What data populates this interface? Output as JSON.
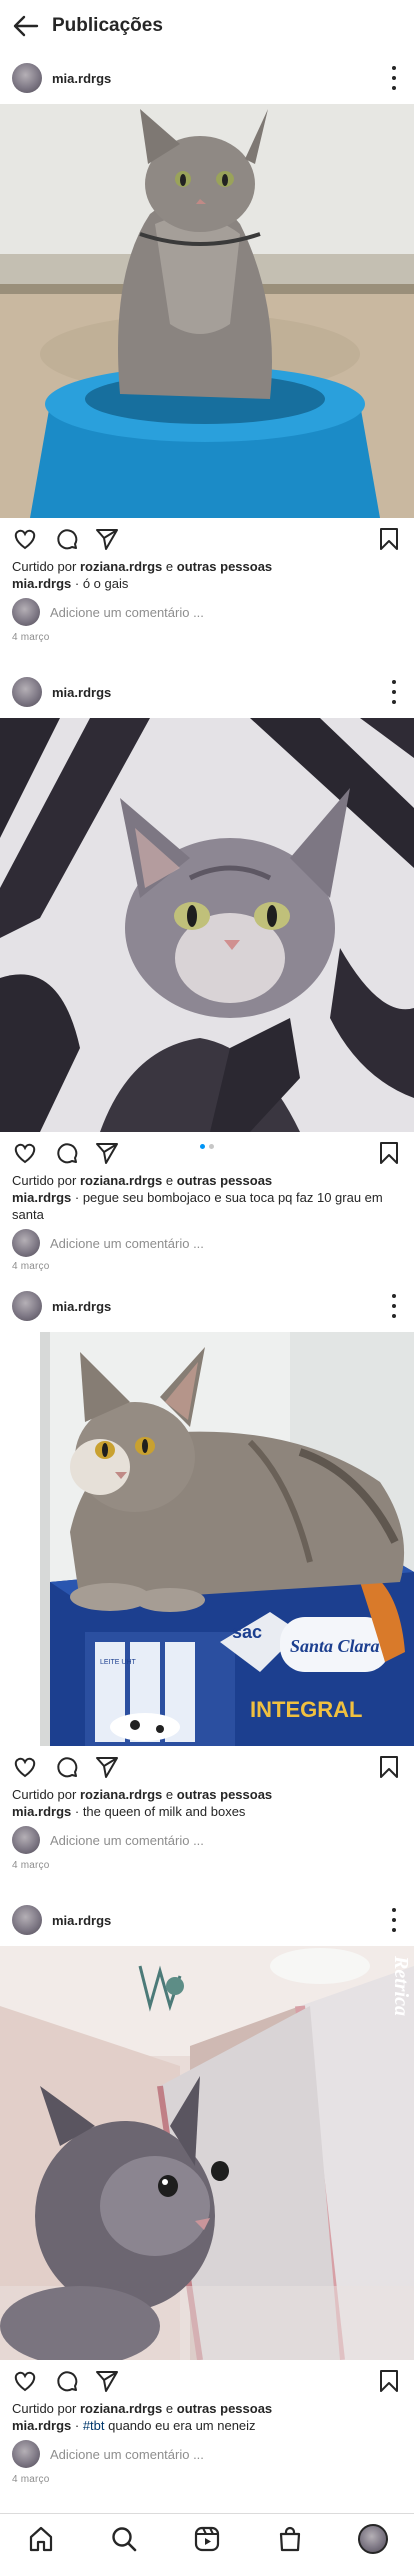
{
  "header": {
    "title": "Publicações",
    "back_icon": "arrow-left-icon"
  },
  "posts": [
    {
      "username": "mia.rdrgs",
      "liked_prefix": "Curtido por",
      "liked_user": "roziana.rdrgs",
      "liked_joiner": "e",
      "liked_others": "outras pessoas",
      "caption_user": "mia.rdrgs",
      "caption_sep": " · ",
      "caption_text": "ó o gais",
      "hashtag": "",
      "comment_placeholder": "Adicione um comentário ...",
      "date": "4 março",
      "photo_icon": "cat-on-blue-stool-photo"
    },
    {
      "username": "mia.rdrgs",
      "liked_prefix": "Curtido por",
      "liked_user": "roziana.rdrgs",
      "liked_joiner": "e",
      "liked_others": "outras pessoas",
      "caption_user": "mia.rdrgs",
      "caption_sep": " · ",
      "caption_text": "pegue seu bombojaco e sua toca pq faz 10 grau em santa",
      "hashtag": "",
      "comment_placeholder": "Adicione um comentário ...",
      "date": "4 março",
      "carousel": {
        "count": 2,
        "active": 1
      },
      "photo_icon": "cat-in-zebra-blanket-photo"
    },
    {
      "username": "mia.rdrgs",
      "liked_prefix": "Curtido por",
      "liked_user": "roziana.rdrgs",
      "liked_joiner": "e",
      "liked_others": "outras pessoas",
      "caption_user": "mia.rdrgs",
      "caption_sep": " · ",
      "caption_text": "the queen of milk and boxes",
      "hashtag": "",
      "comment_placeholder": "Adicione um comentário ...",
      "date": "4 março",
      "photo_icon": "cat-on-milk-box-photo",
      "box_texts": {
        "brand": "Santa Clara",
        "integral": "INTEGRAL",
        "leite": "LEITE UHT",
        "sac": "sac"
      }
    },
    {
      "username": "mia.rdrgs",
      "liked_prefix": "Curtido por",
      "liked_user": "roziana.rdrgs",
      "liked_joiner": "e",
      "liked_others": "outras pessoas",
      "caption_user": "mia.rdrgs",
      "caption_sep": " · ",
      "caption_text": " quando eu era um neneiz",
      "hashtag": "#tbt",
      "comment_placeholder": "Adicione um comentário ...",
      "date": "4 março",
      "photo_icon": "kitten-in-mirror-photo",
      "watermark": "Retrica"
    }
  ],
  "bottom_nav": [
    {
      "icon": "home-icon"
    },
    {
      "icon": "search-icon"
    },
    {
      "icon": "reels-icon"
    },
    {
      "icon": "shop-icon"
    },
    {
      "icon": "profile-avatar-icon"
    }
  ],
  "colors": {
    "accent": "#0095f6",
    "text": "#262626",
    "muted": "#8e8e8e",
    "hashtag": "#00376b"
  }
}
